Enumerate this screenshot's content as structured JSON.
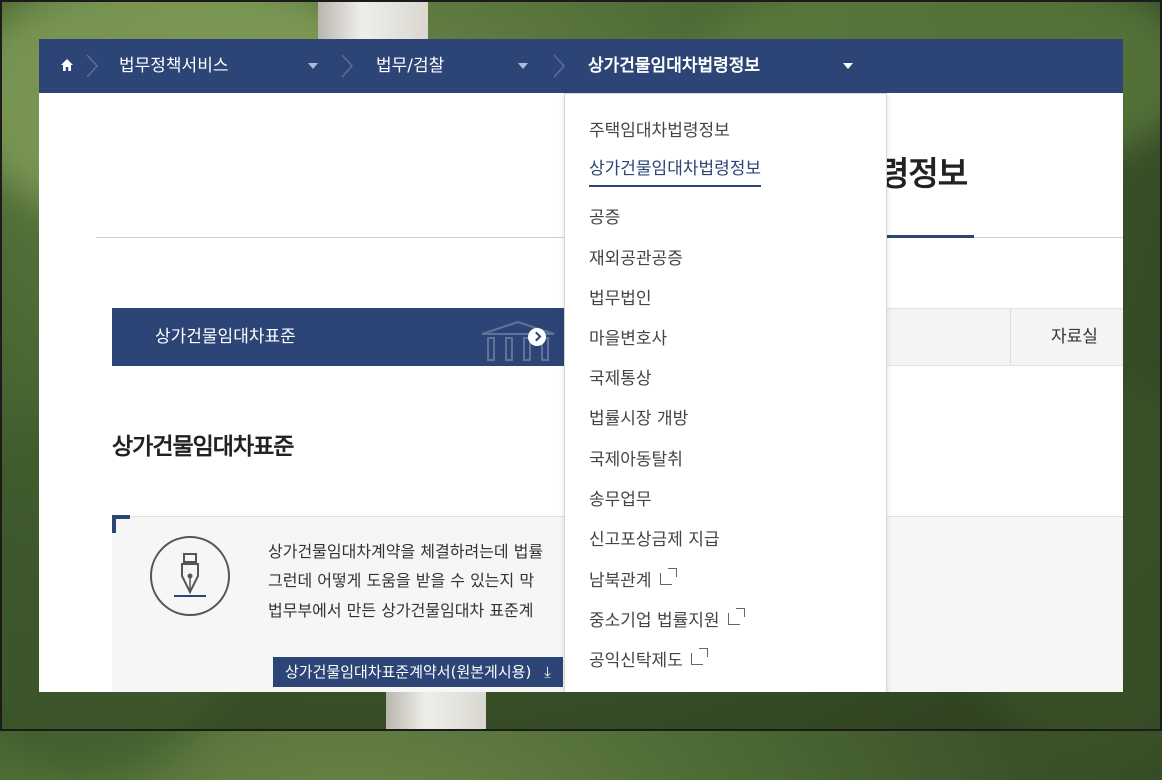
{
  "breadcrumb": {
    "home_icon": "home-icon",
    "items": [
      "법무정책서비스",
      "법무/검찰",
      "상가건물임대차법령정보"
    ]
  },
  "page_title_partial": "령정보",
  "tabs": {
    "active": "상가건물임대차표준",
    "other": "자료실"
  },
  "section": {
    "title": "상가건물임대차표준",
    "lines": [
      "상가건물임대차계약을 체결하려는데 법률",
      "그런데 어떻게 도움을 받을 수 있는지 막",
      "법무부에서 만든 상가건물임대차 표준계"
    ],
    "download_label": "상가건물임대차표준계약서(원본게시용)"
  },
  "dropdown": {
    "items": [
      {
        "label": "주택임대차법령정보",
        "external": false
      },
      {
        "label": "상가건물임대차법령정보",
        "external": false,
        "active": true
      },
      {
        "label": "공증",
        "external": false
      },
      {
        "label": "재외공관공증",
        "external": false
      },
      {
        "label": "법무법인",
        "external": false
      },
      {
        "label": "마을변호사",
        "external": false
      },
      {
        "label": "국제통상",
        "external": false
      },
      {
        "label": "법률시장 개방",
        "external": false
      },
      {
        "label": "국제아동탈취",
        "external": false
      },
      {
        "label": "송무업무",
        "external": false
      },
      {
        "label": "신고포상금제 지급",
        "external": false
      },
      {
        "label": "남북관계",
        "external": true
      },
      {
        "label": "중소기업 법률지원",
        "external": true
      },
      {
        "label": "공익신탁제도",
        "external": true
      }
    ]
  },
  "colors": {
    "brand": "#2c4576",
    "text": "#333333"
  }
}
